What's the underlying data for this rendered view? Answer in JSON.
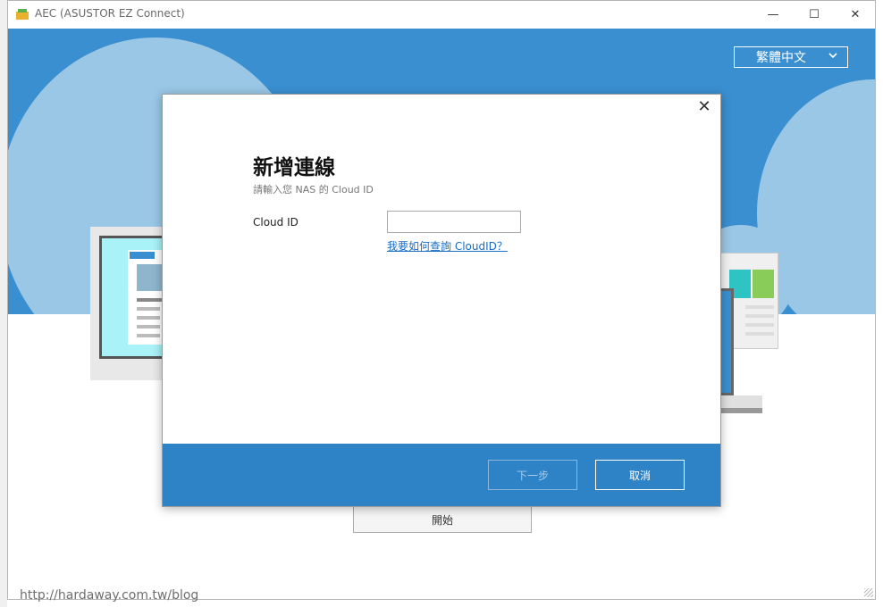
{
  "window": {
    "title": "AEC (ASUSTOR EZ Connect)",
    "controls": {
      "minimize": "—",
      "maximize": "☐",
      "close": "✕"
    }
  },
  "language": {
    "selected": "繁體中文"
  },
  "main": {
    "start_label": "開始"
  },
  "dialog": {
    "title": "新增連線",
    "subtitle": "請輸入您 NAS 的 Cloud ID",
    "field_label": "Cloud ID",
    "input_value": "",
    "help_link": "我要如何查詢 CloudID？",
    "next_label": "下一步",
    "cancel_label": "取消",
    "close_glyph": "✕"
  },
  "overlay": {
    "watermark": "http://hardaway.com.tw/blog"
  },
  "colors": {
    "accent": "#3a8fd0",
    "footer": "#2e82c6",
    "link": "#1a6dc4"
  }
}
